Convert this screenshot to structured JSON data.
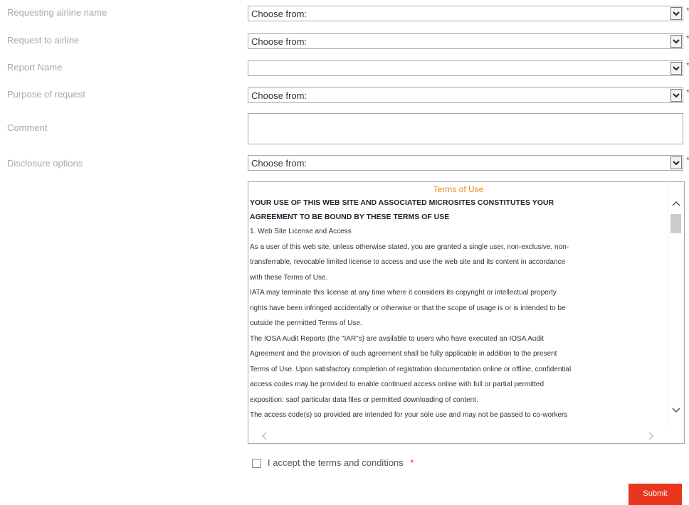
{
  "form": {
    "fields": [
      {
        "label": "Requesting airline name",
        "value": "Choose from:",
        "required": "*"
      },
      {
        "label": "Request to airline",
        "value": "Choose from:",
        "required": "*"
      },
      {
        "label": "Report Name",
        "value": "",
        "required": "*"
      },
      {
        "label": "Purpose of request",
        "value": "Choose from:",
        "required": "*"
      },
      {
        "label": "Comment",
        "value": ""
      },
      {
        "label": "Disclosure options",
        "value": "Choose from:",
        "required": "*"
      }
    ],
    "terms": {
      "title": "Terms of Use",
      "heading_line1": "YOUR USE OF THIS WEB SITE AND ASSOCIATED MICROSITES CONSTITUTES YOUR",
      "heading_line2": "AGREEMENT TO BE BOUND BY THESE TERMS OF USE",
      "lines": [
        "1. Web Site License and Access",
        "As a user of this web site, unless otherwise stated, you are granted a single user, non-exclusive, non-",
        "transferrable, revocable limited license to access and use the web site and its content in accordance",
        "with these Terms of Use.",
        "IATA may terminate this license at any time where it considers its copyright or intellectual property",
        "rights have been infringed accidentally or otherwise or that the scope of usage is or is intended to be",
        "outside the permitted Terms of Use.",
        "The IOSA Audit Reports (the \"IAR\"s) are available to users who have executed an IOSA Audit",
        "Agreement and the provision of such agreement shall be fully applicable in addition to the present",
        "Terms of Use. Upon satisfactory completion of registration documentation online or offline, confidential",
        "access codes may be provided to enable continued access online with full or partial permitted",
        "exposition: saof particular data files or permitted downloading of content.",
        "The access code(s) so provided are intended for your sole use and may not be passed to co-workers"
      ]
    },
    "accept_label": "I accept the terms and conditions",
    "accept_required": "*",
    "submit_label": "Submit"
  }
}
